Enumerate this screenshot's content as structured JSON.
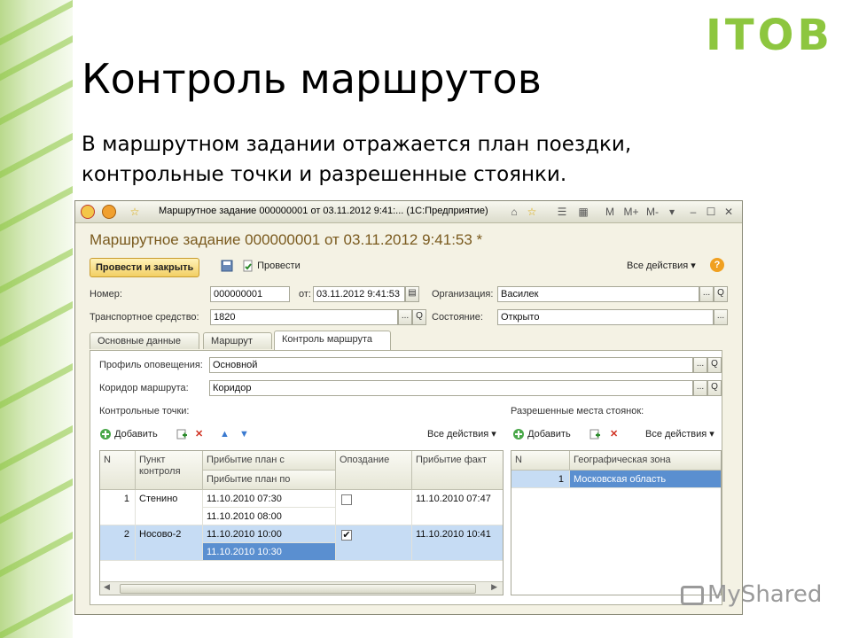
{
  "slide": {
    "logo": "ITOB",
    "title": "Контроль маршрутов",
    "subtitle_line1": "В маршрутном задании отражается план поездки,",
    "subtitle_line2": "контрольные точки и разрешенные стоянки.",
    "watermark": "MyShared"
  },
  "window": {
    "title": "Маршрутное задание 000000001 от 03.11.2012 9:41:... (1С:Предприятие)",
    "tb_m": "M",
    "tb_mplus": "M+",
    "tb_mminus": "M-",
    "form_title": "Маршрутное задание 000000001 от 03.11.2012 9:41:53 *"
  },
  "toolbar": {
    "post_close": "Провести и закрыть",
    "post": "Провести",
    "all_actions": "Все действия ▾",
    "help": "?"
  },
  "fields": {
    "number_label": "Номер:",
    "number_value": "000000001",
    "from_label": "от:",
    "date_value": "03.11.2012  9:41:53",
    "org_label": "Организация:",
    "org_value": "Василек",
    "vehicle_label": "Транспортное средство:",
    "vehicle_value": "1820",
    "state_label": "Состояние:",
    "state_value": "Открыто",
    "dots": "...",
    "search": "Q"
  },
  "tabs": [
    "Основные данные",
    "Маршрут",
    "Контроль маршрута"
  ],
  "control": {
    "profile_label": "Профиль оповещения:",
    "profile_value": "Основной",
    "corridor_label": "Коридор маршрута:",
    "corridor_value": "Коридор",
    "checkpoints_label": "Контрольные точки:",
    "parking_label": "Разрешенные места стоянок:",
    "add": "Добавить",
    "all_actions": "Все действия ▾"
  },
  "checkpoints_table": {
    "headers": {
      "n": "N",
      "point": "Пункт контроля",
      "arrive_from": "Прибытие план с",
      "arrive_to": "Прибытие план по",
      "late": "Опоздание",
      "fact": "Прибытие факт"
    },
    "rows": [
      {
        "n": "1",
        "point": "Стенино",
        "from": "11.10.2010 07:30",
        "to": "11.10.2010 08:00",
        "late": "",
        "fact": "11.10.2010 07:47"
      },
      {
        "n": "2",
        "point": "Носово-2",
        "from": "11.10.2010 10:00",
        "to": "11.10.2010 10:30",
        "late": "✔",
        "fact": "11.10.2010 10:41"
      }
    ]
  },
  "parking_table": {
    "headers": {
      "n": "N",
      "zone": "Географическая зона"
    },
    "rows": [
      {
        "n": "1",
        "zone": "Московская область"
      }
    ]
  },
  "colors": {
    "accent": "#8dc63f",
    "selection": "#5a8fd0",
    "form_title": "#7a5a1e"
  }
}
